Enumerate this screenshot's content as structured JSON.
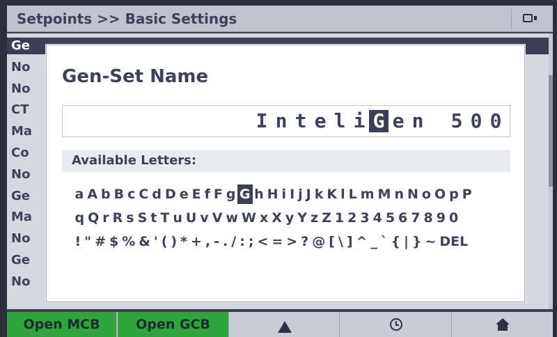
{
  "titlebar": {
    "title": "Setpoints >> Basic Settings",
    "icon": "screen-switch-icon"
  },
  "list": {
    "rows": [
      "Ge",
      "No",
      "No",
      "CT",
      "Ma",
      "Co",
      "No",
      "Ge",
      "Ma",
      "No",
      "Ge",
      "No"
    ],
    "selected_index": 0
  },
  "dialog": {
    "title": "Gen-Set Name",
    "name_value": [
      "I",
      "n",
      "t",
      "e",
      "l",
      "i",
      "G",
      "e",
      "n",
      " ",
      "5",
      "0",
      "0"
    ],
    "cursor_index": 6,
    "available_label": "Available Letters:",
    "letter_rows": [
      [
        "a",
        "A",
        "b",
        "B",
        "c",
        "C",
        "d",
        "D",
        "e",
        "E",
        "f",
        "F",
        "g",
        "G",
        "h",
        "H",
        "i",
        "I",
        "j",
        "J",
        "k",
        "K",
        "l",
        "L",
        "m",
        "M",
        "n",
        "N",
        "o",
        "O",
        "p",
        "P"
      ],
      [
        "q",
        "Q",
        "r",
        "R",
        "s",
        "S",
        "t",
        "T",
        "u",
        "U",
        "v",
        "V",
        "w",
        "W",
        "x",
        "X",
        "y",
        "Y",
        "z",
        "Z",
        "1",
        "2",
        "3",
        "4",
        "5",
        "6",
        "7",
        "8",
        "9",
        "0"
      ],
      [
        "!",
        "\"",
        "#",
        "$",
        "%",
        "&",
        "'",
        "(",
        ")",
        "*",
        "+",
        ",",
        "-",
        ".",
        "/",
        ":",
        ";",
        "<",
        "=",
        ">",
        "?",
        "@",
        "[",
        "\\",
        "]",
        "^",
        "_",
        "`",
        "{",
        "|",
        "}",
        "~",
        "DEL"
      ]
    ],
    "selected_letter": {
      "row": 0,
      "col": 13
    }
  },
  "bottombar": {
    "open_mcb": "Open MCB",
    "open_gcb": "Open GCB",
    "icons": [
      "warning-icon",
      "history-icon",
      "home-icon"
    ],
    "green": "#2ea43a"
  }
}
